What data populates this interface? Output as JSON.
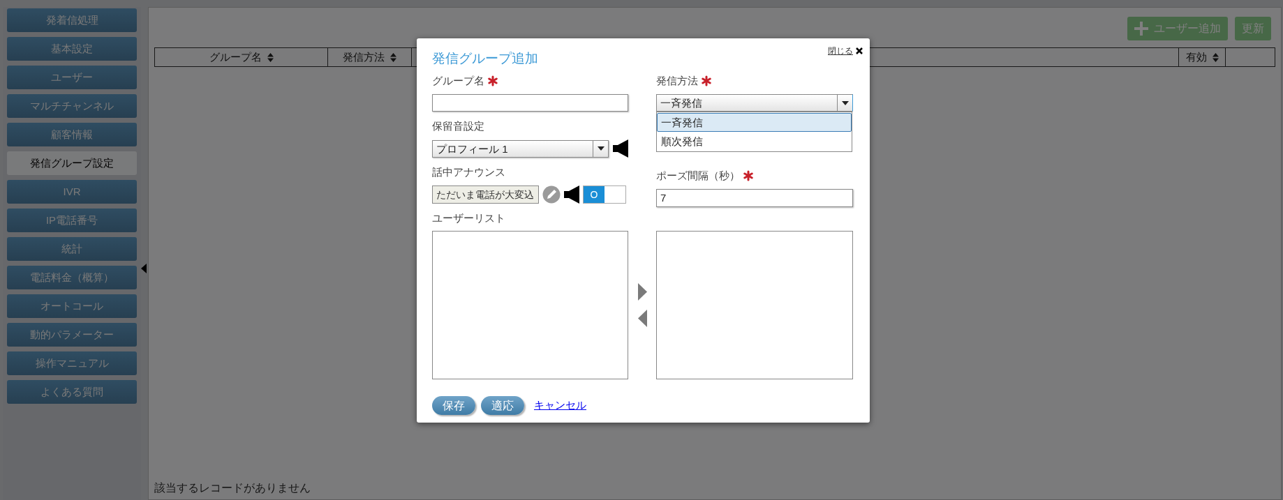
{
  "sidebar": {
    "items": [
      {
        "label": "発着信処理",
        "selected": false
      },
      {
        "label": "基本設定",
        "selected": false
      },
      {
        "label": "ユーザー",
        "selected": false
      },
      {
        "label": "マルチチャンネル",
        "selected": false
      },
      {
        "label": "顧客情報",
        "selected": false
      },
      {
        "label": "発信グループ設定",
        "selected": true
      },
      {
        "label": "IVR",
        "selected": false
      },
      {
        "label": "IP電話番号",
        "selected": false
      },
      {
        "label": "統計",
        "selected": false
      },
      {
        "label": "電話料金（概算）",
        "selected": false
      },
      {
        "label": "オートコール",
        "selected": false
      },
      {
        "label": "動的パラメーター",
        "selected": false
      },
      {
        "label": "操作マニュアル",
        "selected": false
      },
      {
        "label": "よくある質問",
        "selected": false
      }
    ]
  },
  "toolbar": {
    "buttons": [
      {
        "label": "ユーザー追加",
        "kind": "add"
      },
      {
        "label": "更新",
        "kind": "plain"
      }
    ]
  },
  "table": {
    "columns": [
      {
        "label": "グループ名",
        "sortable": true
      },
      {
        "label": "発信方法",
        "sortable": true
      },
      {
        "label": "有効",
        "sortable": true
      }
    ],
    "empty_message": "該当するレコードがありません"
  },
  "dialog": {
    "title": "発信グループ追加",
    "close_label": "閉じる",
    "group_name": {
      "label": "グループ名",
      "required": true
    },
    "method": {
      "label": "発信方法",
      "required": true,
      "value": "一斉発信",
      "expanded": true,
      "options": [
        {
          "label": "一斉発信",
          "selected": true
        },
        {
          "label": "順次発信",
          "selected": false
        }
      ]
    },
    "hold_music": {
      "label": "保留音設定",
      "value": "プロフィール 1"
    },
    "busy_announce": {
      "label": "話中アナウンス",
      "value": "ただいま電話が大変込",
      "toggle": {
        "label": "O",
        "on": true
      }
    },
    "pause": {
      "label": "ポーズ間隔（秒）",
      "required": true,
      "value": "7"
    },
    "user_list": {
      "label": "ユーザーリスト"
    },
    "buttons": [
      {
        "label": "保存",
        "kind": "button"
      },
      {
        "label": "適応",
        "kind": "button"
      },
      {
        "label": "キャンセル",
        "kind": "link"
      }
    ]
  }
}
